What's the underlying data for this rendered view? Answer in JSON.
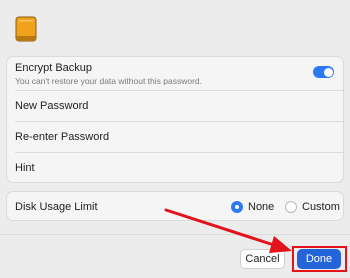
{
  "encrypt": {
    "title": "Encrypt Backup",
    "subtitle": "You can't restore your data without this password.",
    "toggle_on": true
  },
  "fields": {
    "new_password": "New Password",
    "reenter_password": "Re-enter Password",
    "hint": "Hint"
  },
  "disk_usage": {
    "label": "Disk Usage Limit",
    "options": [
      "None",
      "Custom"
    ],
    "selected": "None"
  },
  "buttons": {
    "cancel": "Cancel",
    "done": "Done"
  },
  "colors": {
    "accent": "#2d79f3",
    "annotation": "#e3121b",
    "disk_icon": "#f0a21a"
  },
  "icons": [
    "external-disk-icon",
    "toggle-switch",
    "radio-button",
    "annotation-arrow"
  ]
}
